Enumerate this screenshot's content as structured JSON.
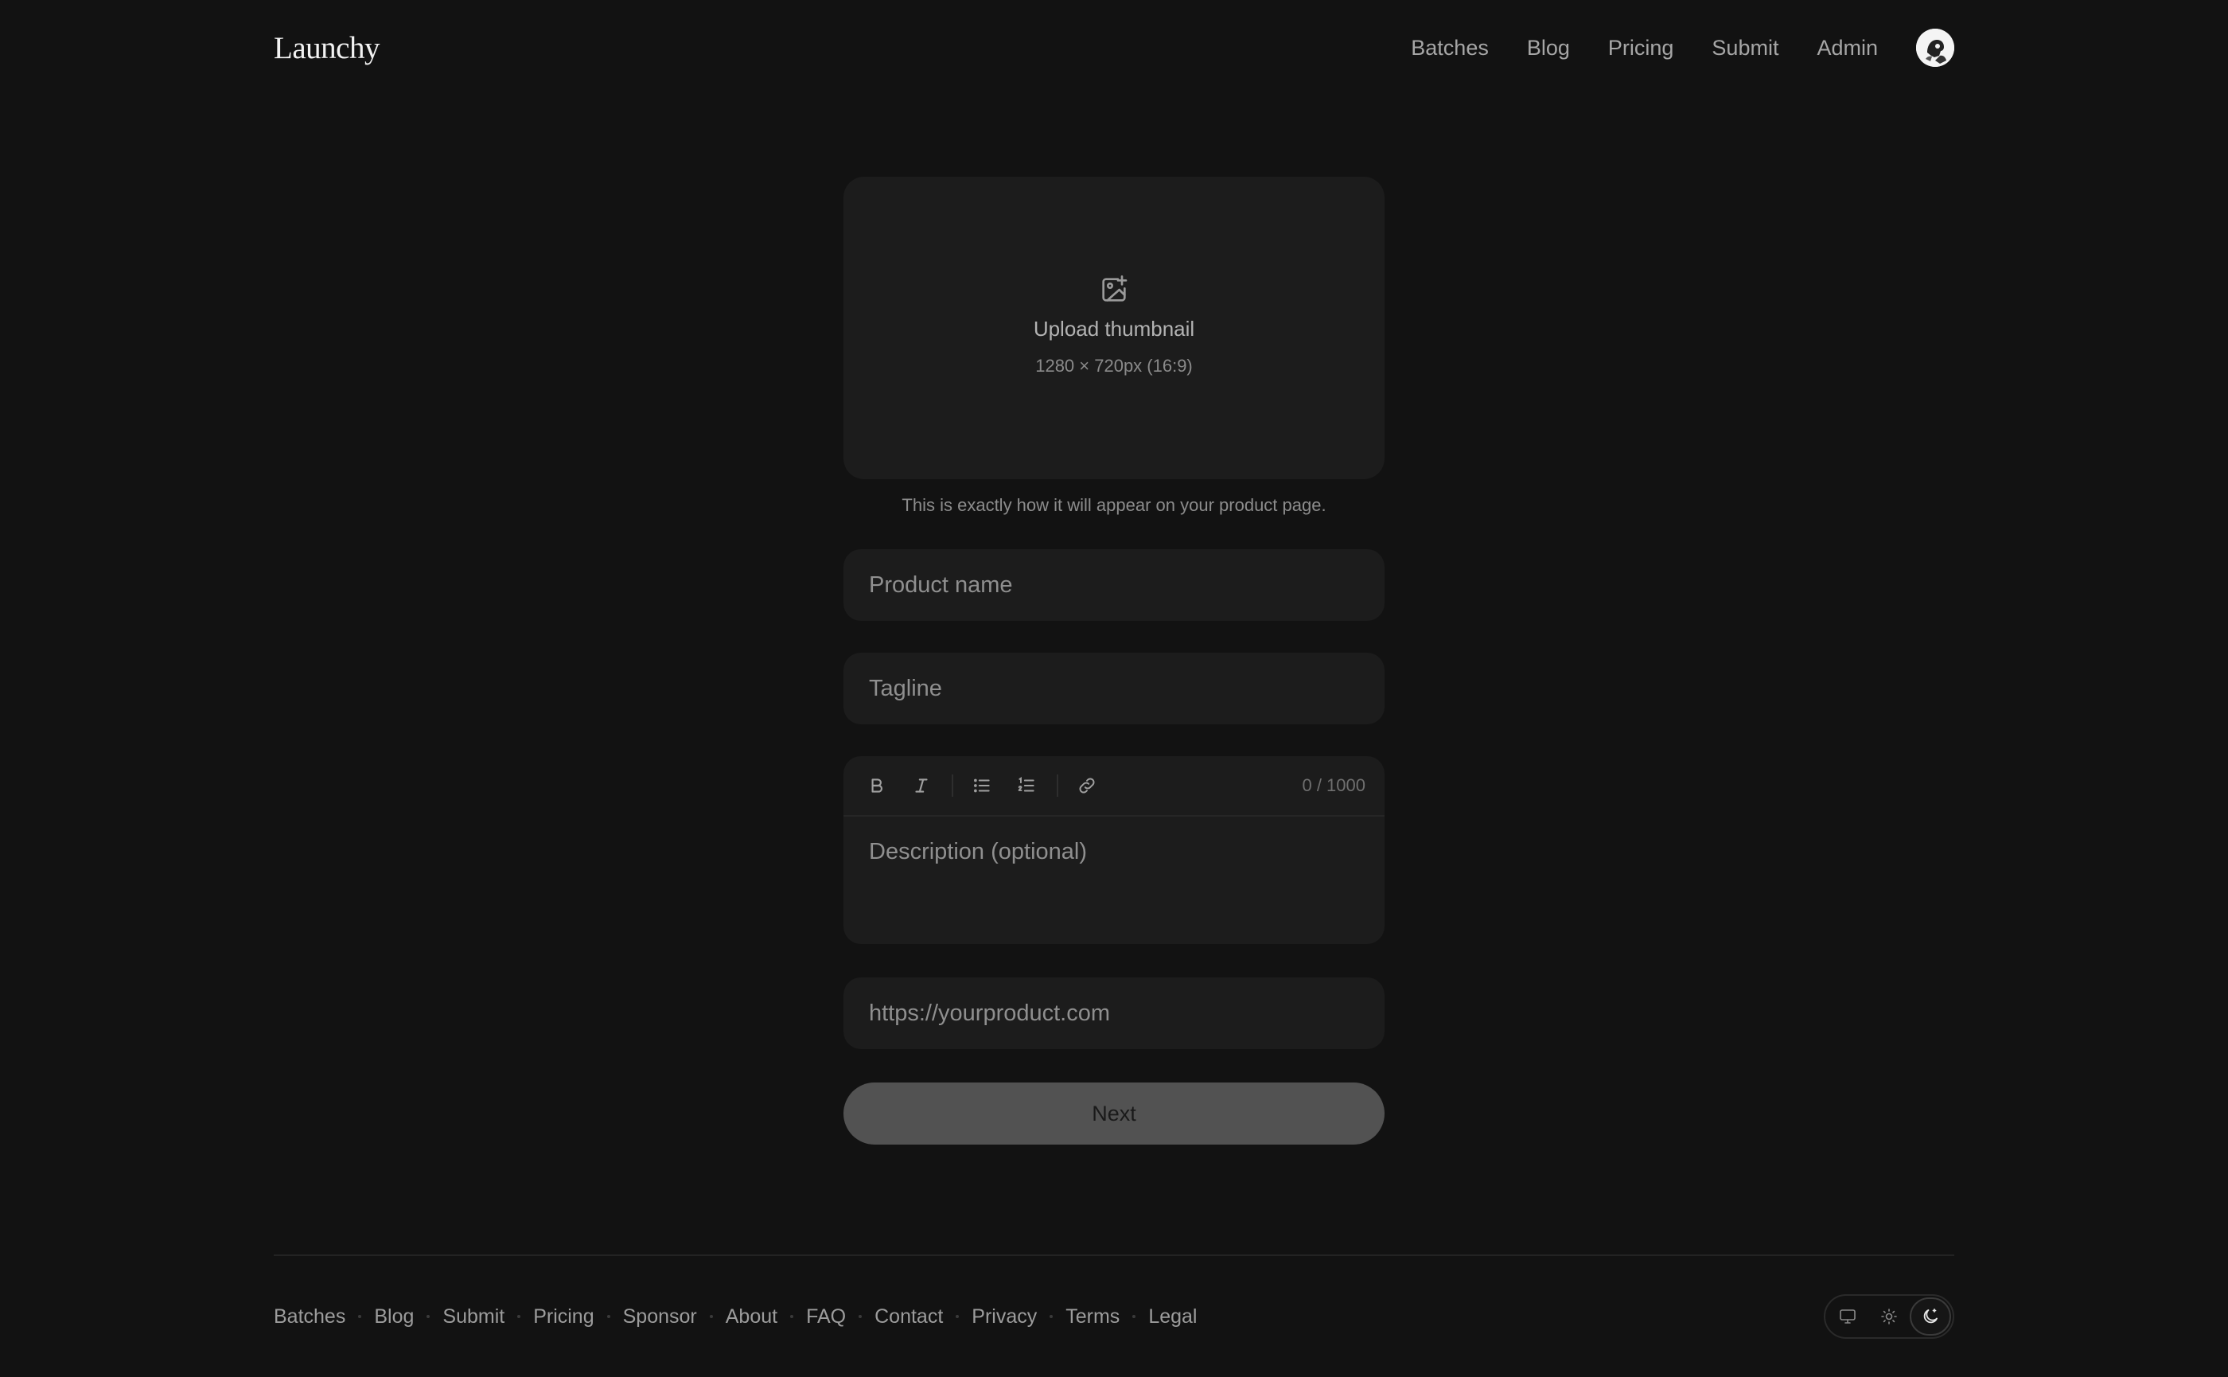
{
  "header": {
    "brand": "Launchy",
    "nav": [
      "Batches",
      "Blog",
      "Pricing",
      "Submit",
      "Admin"
    ]
  },
  "upload": {
    "title": "Upload thumbnail",
    "dimensions": "1280 × 720px (16:9)",
    "hint": "This is exactly how it will appear on your product page."
  },
  "form": {
    "product_name_placeholder": "Product name",
    "tagline_placeholder": "Tagline",
    "description_placeholder": "Description (optional)",
    "char_count": "0 / 1000",
    "url_placeholder": "https://yourproduct.com",
    "next_label": "Next"
  },
  "toolbar": {
    "buttons": [
      "bold-icon",
      "italic-icon",
      "bullet-list-icon",
      "numbered-list-icon",
      "link-icon"
    ]
  },
  "footer": {
    "links": [
      "Batches",
      "Blog",
      "Submit",
      "Pricing",
      "Sponsor",
      "About",
      "FAQ",
      "Contact",
      "Privacy",
      "Terms",
      "Legal"
    ],
    "theme_options": [
      "monitor-icon",
      "sun-icon",
      "moon-icon"
    ],
    "active_theme": "moon-icon"
  },
  "colors": {
    "background": "#121212",
    "surface": "#1c1c1c",
    "button": "#525252"
  }
}
